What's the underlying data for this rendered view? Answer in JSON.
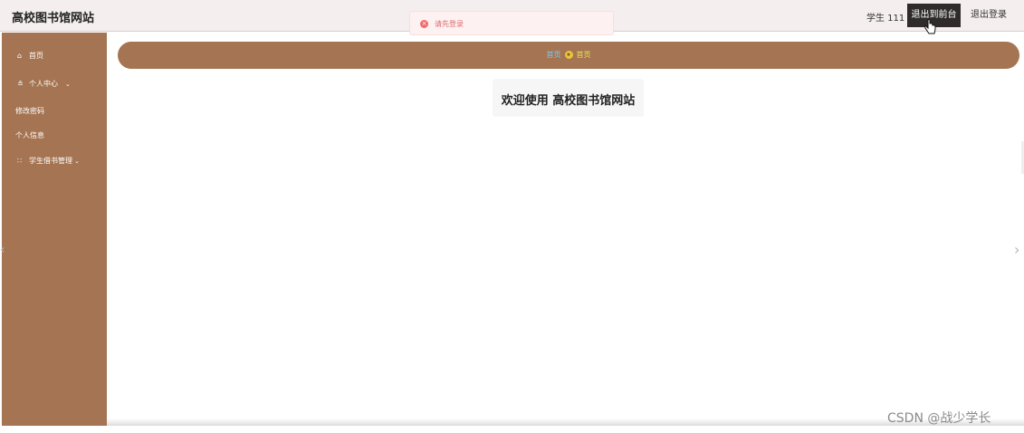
{
  "header": {
    "app_title": "高校图书馆网站",
    "user_label": "学生 111",
    "front_button": "退出到前台",
    "logout_button": "退出登录"
  },
  "toast": {
    "icon": "×",
    "message": "请先登录"
  },
  "sidebar": {
    "items": [
      {
        "label": "首页",
        "icon": "⌂"
      },
      {
        "label": "个人中心",
        "icon": "≗",
        "chevron": "⌄"
      },
      {
        "label": "修改密码"
      },
      {
        "label": "个人信息"
      },
      {
        "label": "学生借书管理",
        "icon": "∷",
        "chevron": "⌄"
      }
    ]
  },
  "breadcrumb": {
    "first": "首页",
    "star": "★",
    "second": "首页"
  },
  "welcome": {
    "text": "欢迎使用 高校图书馆网站"
  },
  "arrows": {
    "left": "‹",
    "right": "›"
  },
  "watermark": "CSDN @战少学长",
  "colors": {
    "sidebar": "#a57452",
    "header": "#f4eeee",
    "active_button": "#2f2b2b",
    "toast_bg": "#fdf1f1",
    "toast_icon": "#f26b6b"
  }
}
